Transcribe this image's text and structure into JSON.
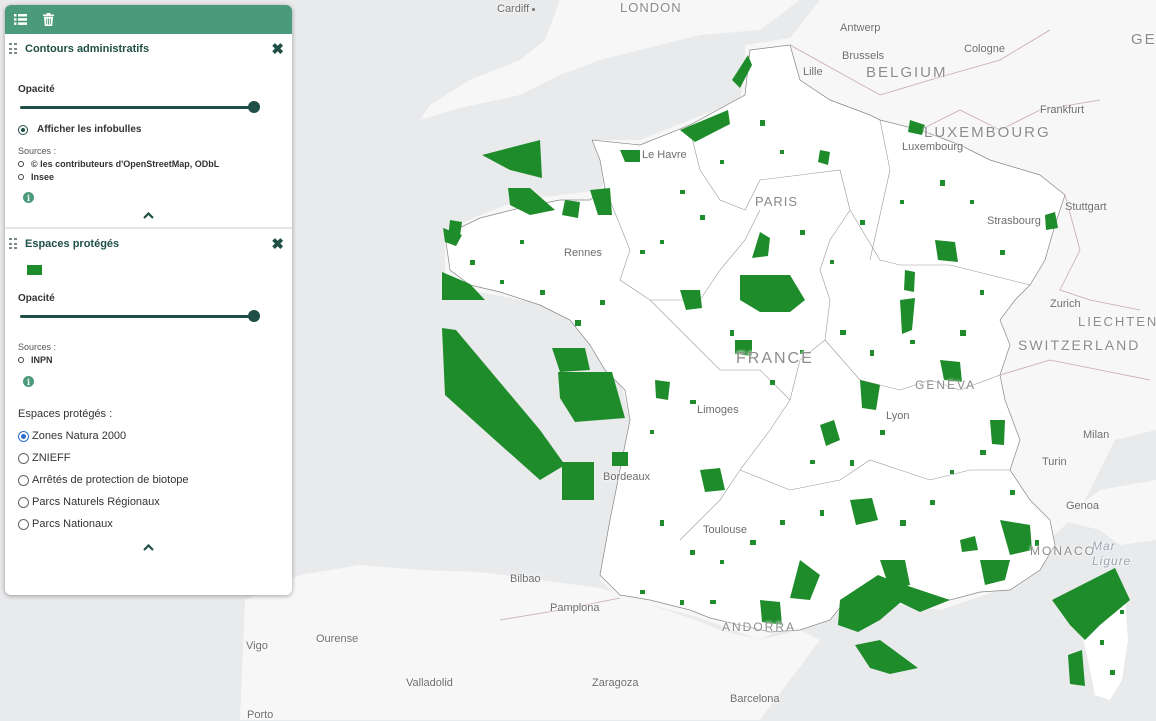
{
  "map": {
    "labels": {
      "cardiff": "Cardiff",
      "london": "LONDON",
      "antwerp": "Antwerp",
      "brussels": "Brussels",
      "belgium": "BELGIUM",
      "cologne": "Cologne",
      "germany_partial": "GE",
      "lille": "Lille",
      "frankfurt": "Frankfurt",
      "luxembourg_country": "LUXEMBOURG",
      "luxembourg_city": "Luxembourg",
      "le_havre": "Le Havre",
      "paris": "PARIS",
      "stuttgart": "Stuttgart",
      "strasbourg": "Strasbourg",
      "rennes": "Rennes",
      "zurich": "Zurich",
      "liechtenstein": "LIECHTENST",
      "france": "FRANCE",
      "switzerland": "SWITZERLAND",
      "geneva": "GENEVA",
      "limoges": "Limoges",
      "lyon": "Lyon",
      "milan": "Milan",
      "turin": "Turin",
      "bordeaux": "Bordeaux",
      "genoa": "Genoa",
      "monaco": "MONACO",
      "mar_ligure": "Mar Ligure",
      "toulouse": "Toulouse",
      "bilbao": "Bilbao",
      "pamplona": "Pamplona",
      "andorra": "ANDORRA",
      "ourense": "Ourense",
      "vigo": "Vigo",
      "valladolid": "Valladolid",
      "zaragoza": "Zaragoza",
      "barcelona": "Barcelona",
      "porto": "Porto"
    },
    "colors": {
      "sea": "#e9eaec",
      "land": "#f7f7f7",
      "france": "#ffffff",
      "protected": "#1e8c2a",
      "borders": "#c9a9a9"
    }
  },
  "panel": {
    "toolbar": {
      "list_icon": "list-icon",
      "trash_icon": "trash-icon"
    },
    "layer1": {
      "title": "Contours administratifs",
      "opacity_label": "Opacité",
      "opacity_value": 1.0,
      "infobulles_label": "Afficher les infobulles",
      "sources_label": "Sources :",
      "sources": [
        "© les contributeurs d'OpenStreetMap, ODbL",
        "Insee"
      ]
    },
    "layer2": {
      "title": "Espaces protégés",
      "opacity_label": "Opacité",
      "opacity_value": 1.0,
      "sources_label": "Sources :",
      "sources": [
        "INPN"
      ],
      "choice_label": "Espaces protégés :",
      "options": [
        "Zones Natura 2000",
        "ZNIEFF",
        "Arrêtés de protection de biotope",
        "Parcs Naturels Régionaux",
        "Parcs Nationaux"
      ],
      "selected": "Zones Natura 2000"
    }
  }
}
